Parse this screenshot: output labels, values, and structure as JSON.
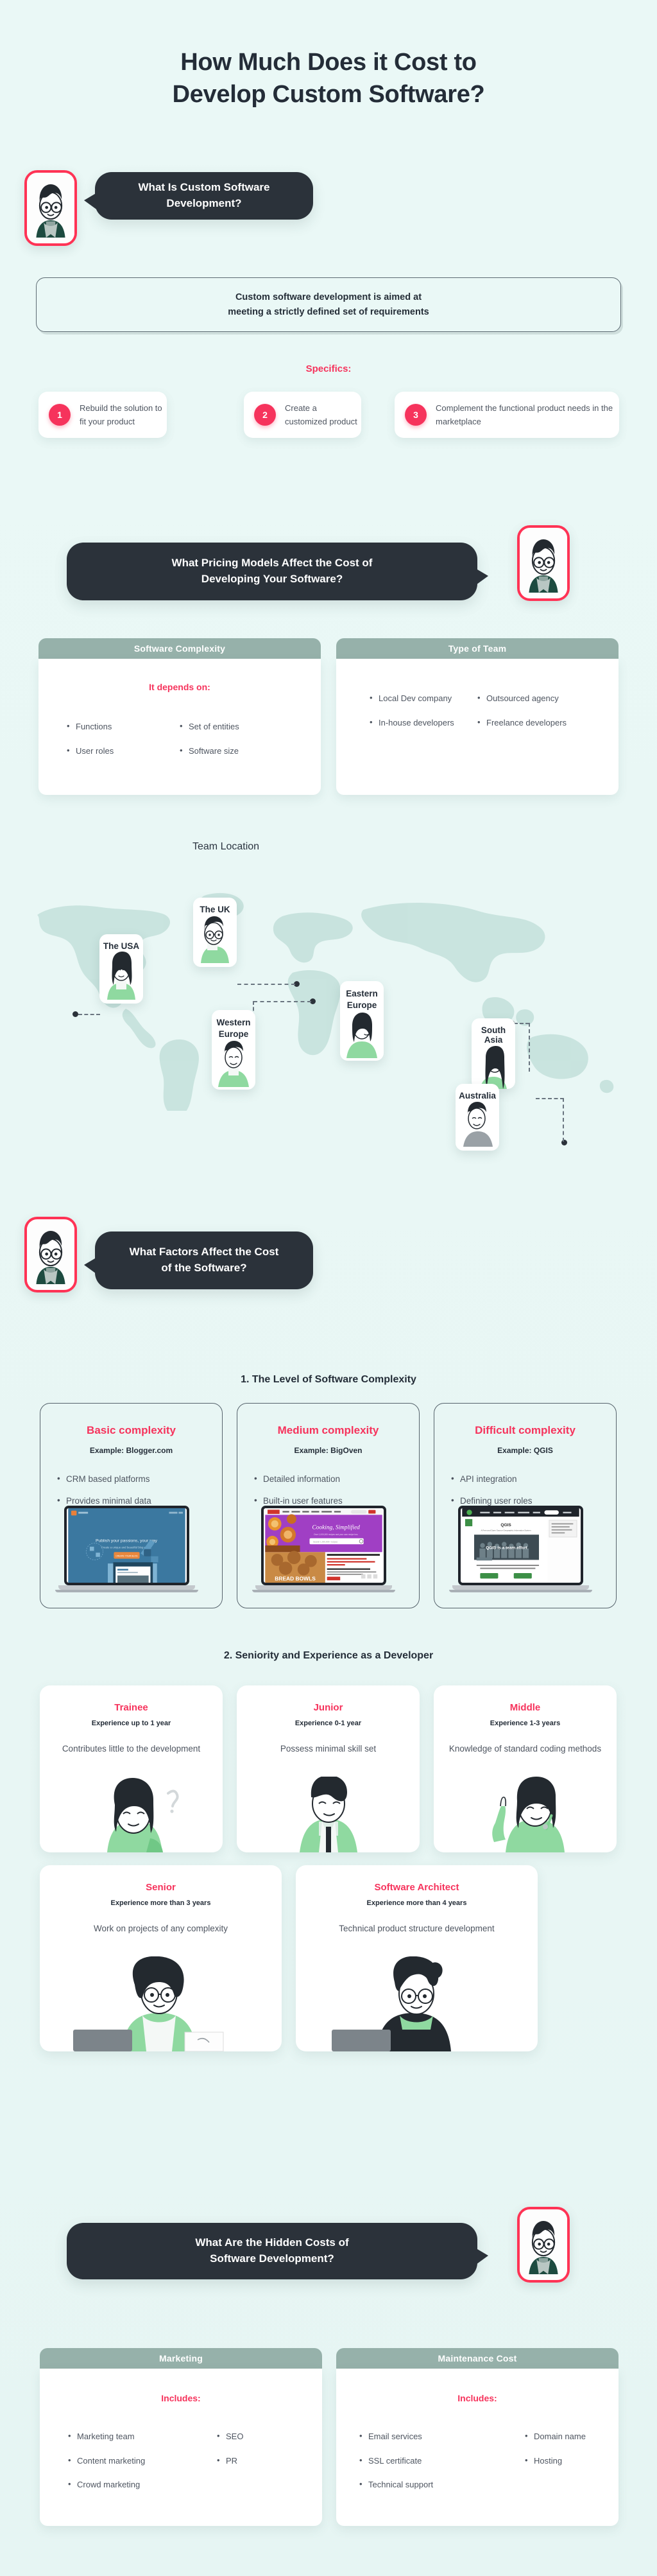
{
  "title": "How Much Does it Cost to\nDevelop Custom Software?",
  "title_line1": "How Much Does it Cost to",
  "title_line2": "Develop Custom Software?",
  "colors": {
    "background": "#eaf7f5",
    "accent_pink": "#f6335c",
    "dark": "#2b323a",
    "sage": "#96b1aa",
    "green": "#8fd9a0",
    "card_white": "#ffffff"
  },
  "q1": {
    "question": "What Is Custom Software Development?",
    "definition_line1": "Custom software development is aimed at",
    "definition_line2": "meeting a strictly defined set of requirements",
    "specifics_label": "Specifics:",
    "specifics": [
      {
        "num": "1",
        "text": "Rebuild the solution to fit your product"
      },
      {
        "num": "2",
        "text": "Create a customized product"
      },
      {
        "num": "3",
        "text": "Complement the functional product needs in the marketplace"
      }
    ]
  },
  "q2": {
    "question_line1": "What Pricing Models Affect the Cost of",
    "question_line2": "Developing Your Software?",
    "complexity_panel": {
      "header": "Software Complexity",
      "sub_label": "It depends on:",
      "col1": [
        "Functions",
        "User roles"
      ],
      "col2": [
        "Set of entities",
        "Software size"
      ]
    },
    "team_panel": {
      "header": "Type of Team",
      "col1": [
        "Local Dev company",
        "In-house developers"
      ],
      "col2": [
        "Outsourced agency",
        "Freelance developers"
      ]
    },
    "team_location": {
      "header": "Team Location",
      "locations": [
        {
          "name": "The UK"
        },
        {
          "name": "The USA"
        },
        {
          "name": "Western Europe"
        },
        {
          "name": "Eastern Europe"
        },
        {
          "name": "South Asia"
        },
        {
          "name": "Australia"
        }
      ]
    }
  },
  "q3": {
    "question_line1": "What Factors Affect the Cost",
    "question_line2": "of the Software?",
    "factor1_heading": "1. The Level of Software Complexity",
    "complexity_levels": [
      {
        "title": "Basic complexity",
        "example": "Example: Blogger.com",
        "bullets": [
          "CRM based platforms",
          "Provides minimal data"
        ],
        "screenshot_headline": "Publish your passions, your way",
        "screenshot_sub": "Create a unique and beautiful blog easily.",
        "screenshot_cta": "CREATE YOUR BLOG"
      },
      {
        "title": "Medium complexity",
        "example": "Example: BigOven",
        "bullets": [
          "Detailed information",
          "Built-in user features"
        ],
        "screenshot_headline": "Cooking, Simplified",
        "screenshot_sub": "Over 1,000,000 recipes and your own recipe box.",
        "screenshot_cta": "BREAD BOWLS"
      },
      {
        "title": "Difficult complexity",
        "example": "Example: QGIS",
        "bullets": [
          "API integration",
          "Defining user roles"
        ],
        "screenshot_headline": "QGIS",
        "screenshot_sub": "A Free and Open Source Geographic Information System",
        "screenshot_cta": "QGIS is a team effort"
      }
    ],
    "factor2_heading": "2. Seniority and Experience as a Developer",
    "seniority": [
      {
        "title": "Trainee",
        "experience": "Experience up to 1 year",
        "description": "Contributes little to the development"
      },
      {
        "title": "Junior",
        "experience": "Experience 0-1 year",
        "description": "Possess minimal skill set"
      },
      {
        "title": "Middle",
        "experience": "Experience 1-3 years",
        "description": "Knowledge of standard coding methods"
      },
      {
        "title": "Senior",
        "experience": "Experience more than 3 years",
        "description": "Work on projects of any complexity"
      },
      {
        "title": "Software Architect",
        "experience": "Experience more than 4 years",
        "description": "Technical product structure development"
      }
    ]
  },
  "q4": {
    "question_line1": "What Are the Hidden Costs of",
    "question_line2": "Software Development?",
    "marketing_panel": {
      "header": "Marketing",
      "sub_label": "Includes:",
      "col1": [
        "Marketing team",
        "Content marketing",
        "Crowd marketing"
      ],
      "col2": [
        "SEO",
        "PR"
      ]
    },
    "maintenance_panel": {
      "header": "Maintenance Cost",
      "sub_label": "Includes:",
      "col1": [
        "Email services",
        "SSL certificate",
        "Technical support"
      ],
      "col2": [
        "Domain name",
        "Hosting"
      ]
    }
  }
}
